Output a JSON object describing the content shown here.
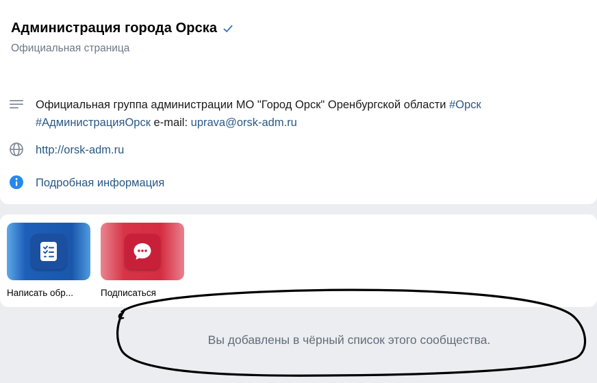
{
  "header": {
    "title": "Администрация города Орска",
    "subtitle": "Официальная страница"
  },
  "info": {
    "description_text": "Официальная группа администрации МО \"Город Орск\" Оренбургской области ",
    "hashtag_1": "#Орск",
    "hashtag_2": "#АдминистрацияОрск",
    "email_label": " e-mail: ",
    "email": "uprava@orsk-adm.ru",
    "website": "http://orsk-adm.ru",
    "more_info": "Подробная информация"
  },
  "actions": [
    {
      "label": "Написать обр...",
      "icon": "checklist-icon"
    },
    {
      "label": "Подписаться",
      "icon": "chat-bubble-icon"
    }
  ],
  "notice": {
    "text": "Вы добавлены в чёрный список этого сообщества."
  },
  "colors": {
    "link": "#2a5885",
    "accent_blue": "#1d5fb9",
    "accent_red": "#d52d41",
    "page_bg": "#ebedf0"
  }
}
